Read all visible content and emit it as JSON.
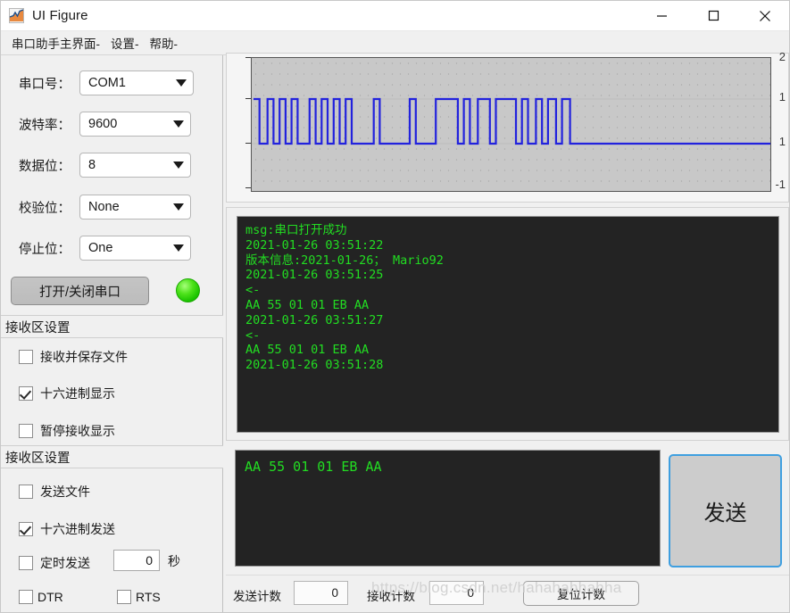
{
  "window": {
    "title": "UI Figure",
    "icon": "matlab-figure-icon",
    "controls": {
      "minimize": "—",
      "maximize": "☐",
      "close": "✕"
    }
  },
  "menubar": {
    "items": [
      {
        "name": "main",
        "label": "串口助手主界面-"
      },
      {
        "name": "settings",
        "label": "设置-"
      },
      {
        "name": "help",
        "label": "帮助-"
      }
    ]
  },
  "settings": {
    "fields": [
      {
        "name": "port",
        "label": "串口号：",
        "value": "COM1"
      },
      {
        "name": "baudrate",
        "label": "波特率：",
        "value": "9600"
      },
      {
        "name": "databits",
        "label": "数据位：",
        "value": "8"
      },
      {
        "name": "parity",
        "label": "校验位：",
        "value": "None"
      },
      {
        "name": "stopbits",
        "label": "停止位：",
        "value": "One"
      }
    ],
    "open_close_button": "打开/关闭串口",
    "led_color": "#33d119"
  },
  "receive_section": {
    "header": "接收区设置",
    "options": [
      {
        "name": "save-to-file",
        "label": "接收并保存文件",
        "checked": false
      },
      {
        "name": "hex-display",
        "label": "十六进制显示",
        "checked": true
      },
      {
        "name": "pause-display",
        "label": "暂停接收显示",
        "checked": false
      }
    ]
  },
  "send_section": {
    "header": "接收区设置",
    "options": [
      {
        "name": "send-file",
        "label": "发送文件",
        "checked": false
      },
      {
        "name": "hex-send",
        "label": "十六进制发送",
        "checked": true
      },
      {
        "name": "timed-send",
        "label": "定时发送",
        "checked": false
      },
      {
        "name": "dtr",
        "label": "DTR",
        "checked": false
      },
      {
        "name": "rts",
        "label": "RTS",
        "checked": false
      }
    ],
    "interval_value": "0",
    "interval_unit": "秒"
  },
  "log": {
    "lines": [
      "msg:串口打开成功",
      "2021-01-26 03:51:22",
      "版本信息:2021-01-26； Mario92",
      "2021-01-26 03:51:25",
      "<-",
      "AA 55 01 01 EB AA",
      "2021-01-26 03:51:27",
      "<-",
      "AA 55 01 01 EB AA",
      "2021-01-26 03:51:28"
    ],
    "text_color": "#22dd22",
    "background_color": "#232323"
  },
  "send_area": {
    "value": "AA 55 01 01 EB AA",
    "button_label": "发送"
  },
  "status_bar": {
    "tx_label": "发送计数",
    "tx_value": "0",
    "rx_label": "接收计数",
    "rx_value": "0",
    "reset_label": "复位计数",
    "watermark": "https://blog.csdn.net/hahahahhahha"
  },
  "chart_data": {
    "type": "line",
    "title": "",
    "xlabel": "",
    "ylabel": "",
    "ylim": [
      -1,
      2
    ],
    "yticks": [
      2,
      1,
      1,
      -1
    ],
    "ytick_labels": [
      "2",
      "1",
      "1",
      "-1"
    ],
    "grid": true,
    "legend": null,
    "series": [
      {
        "name": "serial-waveform",
        "color": "#2222dd",
        "description": "Digital square-wave (UART bit stream) high=1, low=0",
        "x": [
          0,
          3,
          3,
          7,
          7,
          10,
          10,
          13,
          13,
          16,
          16,
          19,
          19,
          22,
          22,
          28,
          28,
          31,
          31,
          34,
          34,
          37,
          37,
          40,
          40,
          43,
          43,
          46,
          46,
          49,
          49,
          60,
          60,
          63,
          63,
          78,
          78,
          81,
          81,
          91,
          91,
          102,
          102,
          105,
          105,
          108,
          108,
          112,
          112,
          118,
          118,
          121,
          121,
          131,
          131,
          134,
          134,
          137,
          137,
          141,
          141,
          144,
          144,
          147,
          147,
          151,
          151,
          154,
          154,
          158,
          158,
          258
        ],
        "y": [
          1,
          1,
          0,
          0,
          1,
          1,
          0,
          0,
          1,
          1,
          0,
          0,
          1,
          1,
          0,
          0,
          1,
          1,
          0,
          0,
          1,
          1,
          0,
          0,
          1,
          1,
          0,
          0,
          1,
          1,
          0,
          0,
          1,
          1,
          0,
          0,
          1,
          1,
          0,
          0,
          1,
          1,
          0,
          0,
          1,
          1,
          0,
          0,
          1,
          1,
          0,
          0,
          1,
          1,
          0,
          0,
          1,
          1,
          0,
          0,
          1,
          1,
          0,
          0,
          1,
          1,
          0,
          0,
          1,
          1,
          0,
          0
        ]
      }
    ]
  }
}
